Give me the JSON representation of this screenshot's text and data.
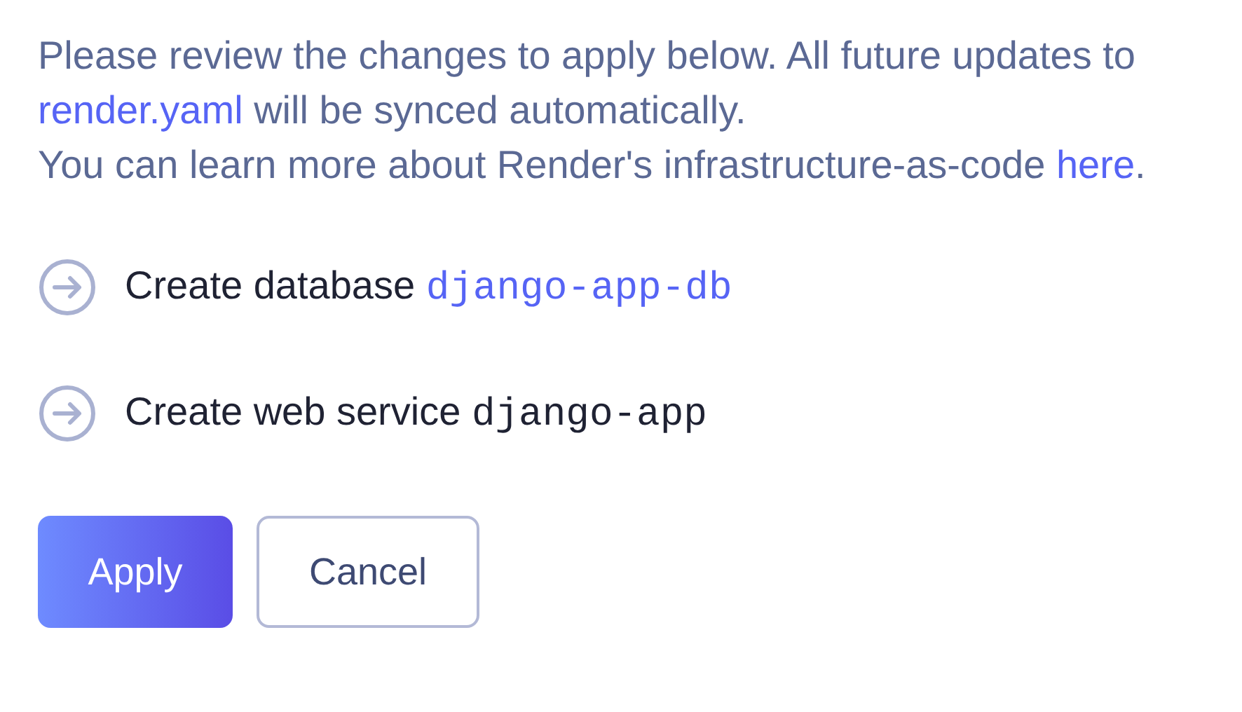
{
  "intro": [
    {
      "before": "Please review the changes to apply below. All future updates to",
      "link": "render.yaml",
      "after": "will be synced automatically."
    },
    {
      "before": "You can learn more about Render's infrastructure-as-code",
      "link": "here",
      "after": "."
    }
  ],
  "actions": [
    {
      "label": "Create database",
      "name": "django-app-db",
      "linked": true
    },
    {
      "label": "Create web service",
      "name": "django-app",
      "linked": false
    }
  ],
  "buttons": [
    {
      "label": "Apply",
      "kind": "primary"
    },
    {
      "label": "Cancel",
      "kind": "secondary"
    }
  ]
}
